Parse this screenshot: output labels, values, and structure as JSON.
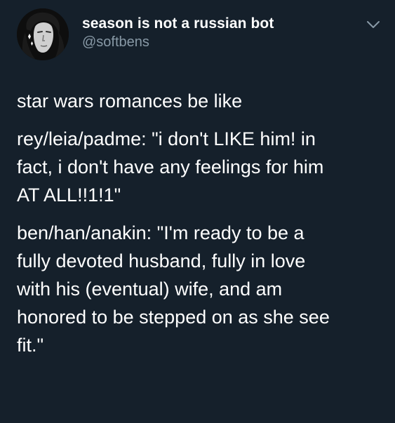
{
  "tweet": {
    "author": {
      "display_name": "season is not a russian bot",
      "handle": "@softbens",
      "avatar_icon": "profile-photo"
    },
    "menu_icon": "chevron-down-icon",
    "paragraphs": [
      "star wars romances be like",
      "rey/leia/padme: \"i don't LIKE him! in\nfact, i don't have any feelings for him\nAT ALL!!1!1\"",
      "ben/han/anakin: \"I'm ready to be a\nfully devoted husband, fully in love\nwith his (eventual) wife, and am\nhonored to be stepped on as she see\nfit.\""
    ]
  },
  "colors": {
    "background": "#15202b",
    "text_primary": "#ffffff",
    "text_secondary": "#8899a6"
  }
}
